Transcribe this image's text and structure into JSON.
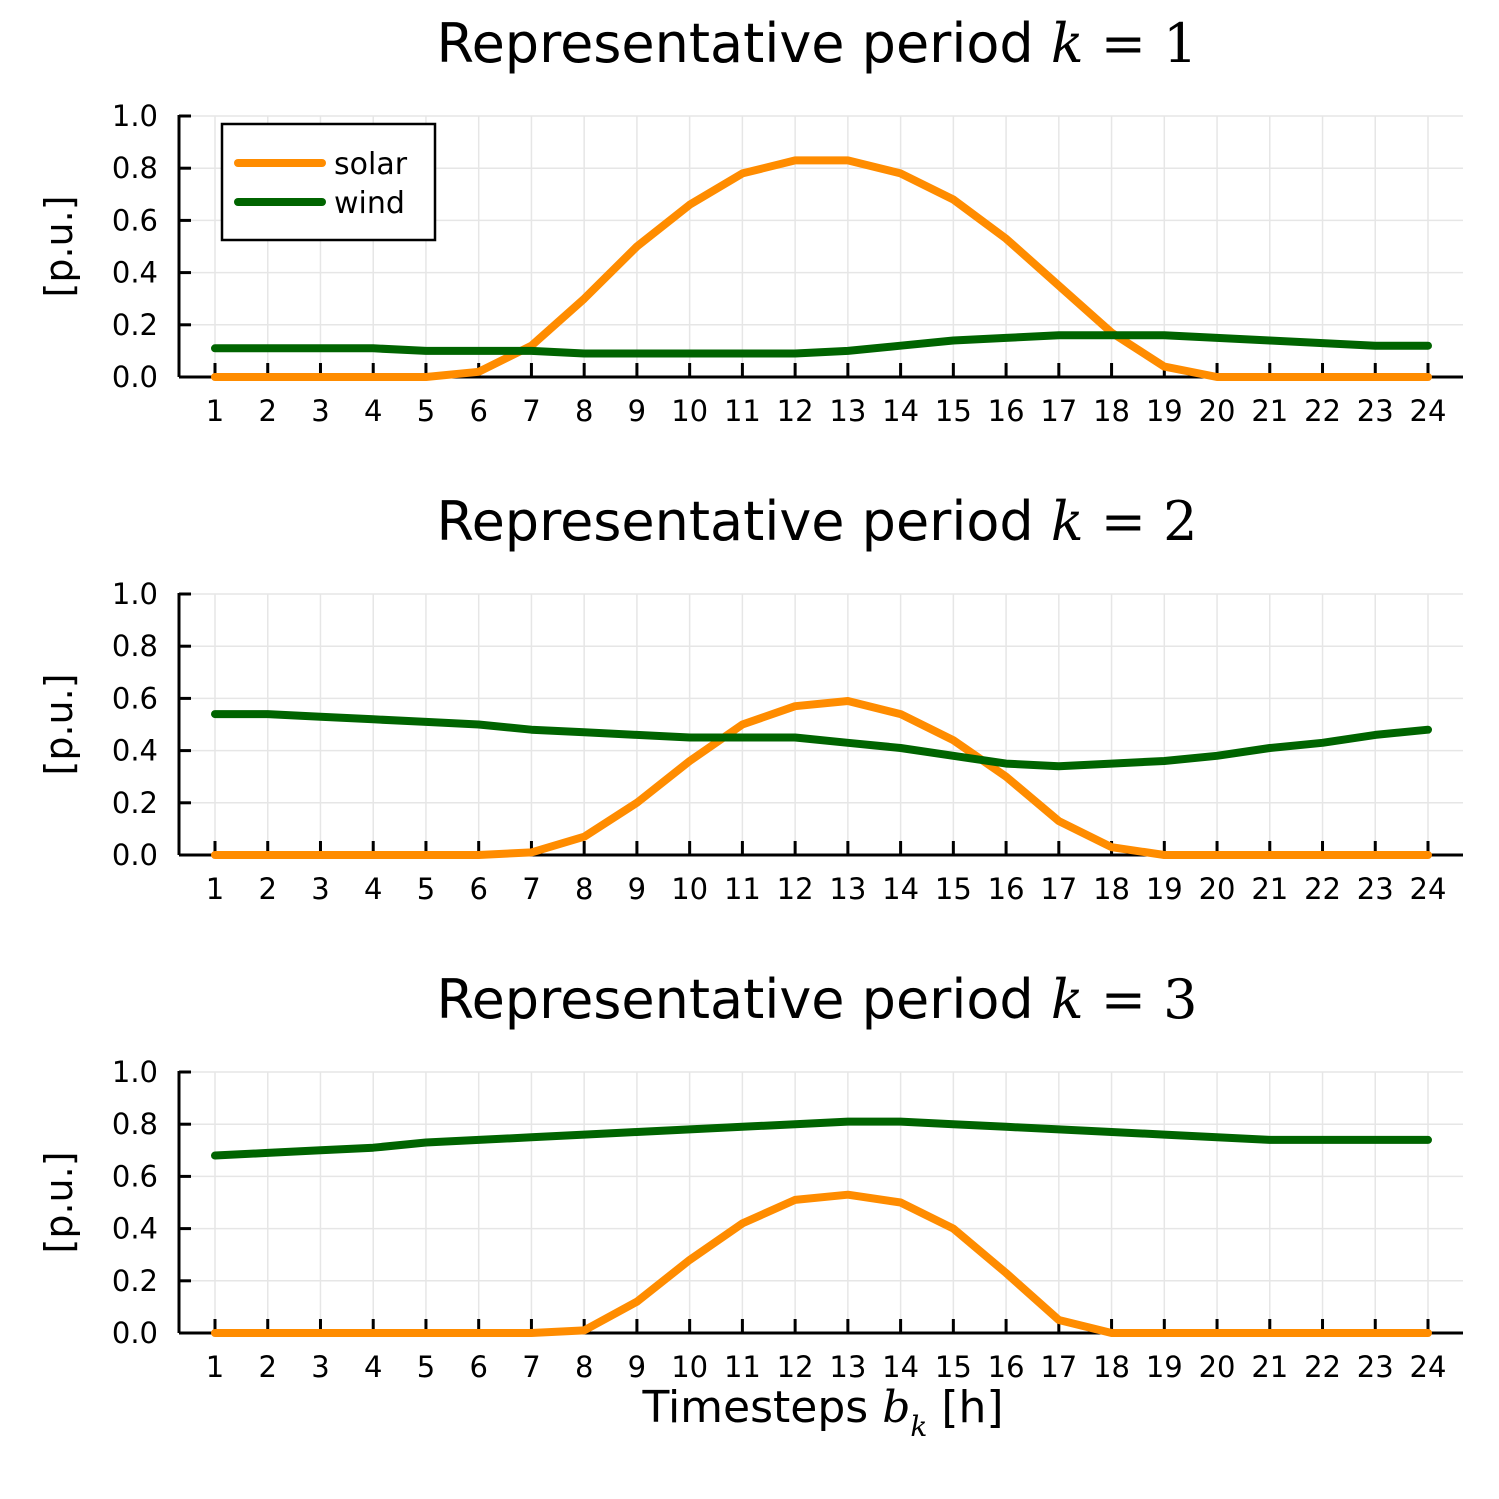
{
  "chart_data": [
    {
      "type": "line",
      "title": "Representative period",
      "title_math": "k = 1",
      "xlabel": "",
      "ylabel": "[p.u.]",
      "x": [
        1,
        2,
        3,
        4,
        5,
        6,
        7,
        8,
        9,
        10,
        11,
        12,
        13,
        14,
        15,
        16,
        17,
        18,
        19,
        20,
        21,
        22,
        23,
        24
      ],
      "xticks": [
        "1",
        "2",
        "3",
        "4",
        "5",
        "6",
        "7",
        "8",
        "9",
        "10",
        "11",
        "12",
        "13",
        "14",
        "15",
        "16",
        "17",
        "18",
        "19",
        "20",
        "21",
        "22",
        "23",
        "24"
      ],
      "yticks": [
        "0.0",
        "0.2",
        "0.4",
        "0.6",
        "0.8",
        "1.0"
      ],
      "ylim": [
        0,
        1
      ],
      "grid": true,
      "legend": {
        "placement": "top-left",
        "entries": [
          "solar",
          "wind"
        ]
      },
      "series": [
        {
          "name": "solar",
          "color": "#ff8c00",
          "values": [
            0,
            0,
            0,
            0,
            0,
            0.02,
            0.12,
            0.3,
            0.5,
            0.66,
            0.78,
            0.83,
            0.83,
            0.78,
            0.68,
            0.53,
            0.35,
            0.17,
            0.04,
            0,
            0,
            0,
            0,
            0
          ]
        },
        {
          "name": "wind",
          "color": "#006400",
          "values": [
            0.11,
            0.11,
            0.11,
            0.11,
            0.1,
            0.1,
            0.1,
            0.09,
            0.09,
            0.09,
            0.09,
            0.09,
            0.1,
            0.12,
            0.14,
            0.15,
            0.16,
            0.16,
            0.16,
            0.15,
            0.14,
            0.13,
            0.12,
            0.12
          ]
        }
      ]
    },
    {
      "type": "line",
      "title": "Representative period",
      "title_math": "k = 2",
      "xlabel": "",
      "ylabel": "[p.u.]",
      "x": [
        1,
        2,
        3,
        4,
        5,
        6,
        7,
        8,
        9,
        10,
        11,
        12,
        13,
        14,
        15,
        16,
        17,
        18,
        19,
        20,
        21,
        22,
        23,
        24
      ],
      "xticks": [
        "1",
        "2",
        "3",
        "4",
        "5",
        "6",
        "7",
        "8",
        "9",
        "10",
        "11",
        "12",
        "13",
        "14",
        "15",
        "16",
        "17",
        "18",
        "19",
        "20",
        "21",
        "22",
        "23",
        "24"
      ],
      "yticks": [
        "0.0",
        "0.2",
        "0.4",
        "0.6",
        "0.8",
        "1.0"
      ],
      "ylim": [
        0,
        1
      ],
      "grid": true,
      "series": [
        {
          "name": "solar",
          "color": "#ff8c00",
          "values": [
            0,
            0,
            0,
            0,
            0,
            0,
            0.01,
            0.07,
            0.2,
            0.36,
            0.5,
            0.57,
            0.59,
            0.54,
            0.44,
            0.3,
            0.13,
            0.03,
            0,
            0,
            0,
            0,
            0,
            0
          ]
        },
        {
          "name": "wind",
          "color": "#006400",
          "values": [
            0.54,
            0.54,
            0.53,
            0.52,
            0.51,
            0.5,
            0.48,
            0.47,
            0.46,
            0.45,
            0.45,
            0.45,
            0.43,
            0.41,
            0.38,
            0.35,
            0.34,
            0.35,
            0.36,
            0.38,
            0.41,
            0.43,
            0.46,
            0.48
          ]
        }
      ]
    },
    {
      "type": "line",
      "title": "Representative period",
      "title_math": "k = 3",
      "xlabel": "Timesteps",
      "xlabel_math": "b_k",
      "xlabel_unit": "[h]",
      "ylabel": "[p.u.]",
      "x": [
        1,
        2,
        3,
        4,
        5,
        6,
        7,
        8,
        9,
        10,
        11,
        12,
        13,
        14,
        15,
        16,
        17,
        18,
        19,
        20,
        21,
        22,
        23,
        24
      ],
      "xticks": [
        "1",
        "2",
        "3",
        "4",
        "5",
        "6",
        "7",
        "8",
        "9",
        "10",
        "11",
        "12",
        "13",
        "14",
        "15",
        "16",
        "17",
        "18",
        "19",
        "20",
        "21",
        "22",
        "23",
        "24"
      ],
      "yticks": [
        "0.0",
        "0.2",
        "0.4",
        "0.6",
        "0.8",
        "1.0"
      ],
      "ylim": [
        0,
        1
      ],
      "grid": true,
      "series": [
        {
          "name": "solar",
          "color": "#ff8c00",
          "values": [
            0,
            0,
            0,
            0,
            0,
            0,
            0,
            0.01,
            0.12,
            0.28,
            0.42,
            0.51,
            0.53,
            0.5,
            0.4,
            0.23,
            0.05,
            0,
            0,
            0,
            0,
            0,
            0,
            0
          ]
        },
        {
          "name": "wind",
          "color": "#006400",
          "values": [
            0.68,
            0.69,
            0.7,
            0.71,
            0.73,
            0.74,
            0.75,
            0.76,
            0.77,
            0.78,
            0.79,
            0.8,
            0.81,
            0.81,
            0.8,
            0.79,
            0.78,
            0.77,
            0.76,
            0.75,
            0.74,
            0.74,
            0.74,
            0.74
          ]
        }
      ]
    }
  ]
}
